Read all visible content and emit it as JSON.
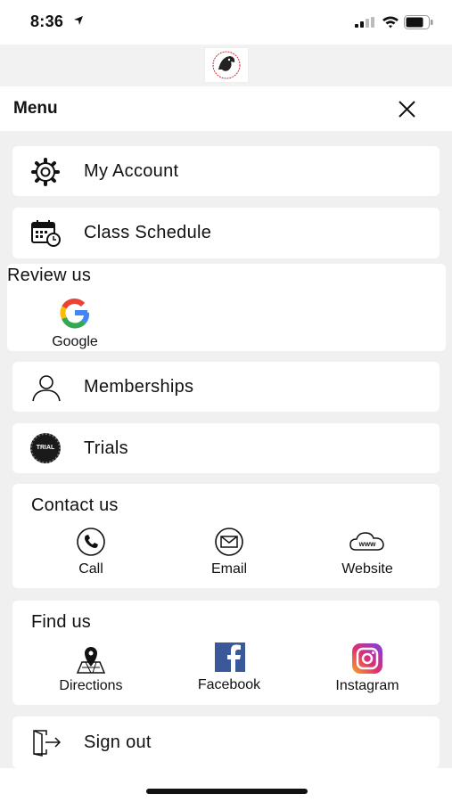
{
  "status": {
    "time": "8:36"
  },
  "menu": {
    "title": "Menu"
  },
  "items": {
    "my_account": "My Account",
    "class_schedule": "Class Schedule",
    "memberships": "Memberships",
    "trials": "Trials",
    "trials_badge": "TRIAL",
    "sign_out": "Sign out"
  },
  "review": {
    "title": "Review us",
    "google": "Google"
  },
  "contact": {
    "title": "Contact us",
    "call": "Call",
    "email": "Email",
    "website": "Website",
    "www": "www"
  },
  "find": {
    "title": "Find us",
    "directions": "Directions",
    "facebook": "Facebook",
    "instagram": "Instagram"
  },
  "colors": {
    "facebook": "#3b5998",
    "background": "#f0f0f0",
    "card": "#ffffff"
  }
}
